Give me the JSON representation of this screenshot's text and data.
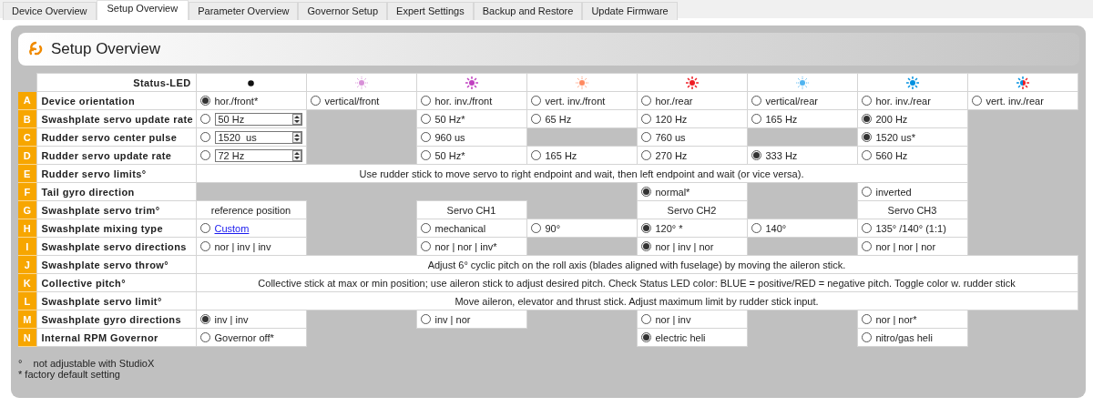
{
  "tabs": [
    {
      "label": "Device Overview",
      "selected": false
    },
    {
      "label": "Setup Overview",
      "selected": true
    },
    {
      "label": "Parameter Overview",
      "selected": false
    },
    {
      "label": "Governor Setup",
      "selected": false
    },
    {
      "label": "Expert Settings",
      "selected": false
    },
    {
      "label": "Backup and Restore",
      "selected": false
    },
    {
      "label": "Update Firmware",
      "selected": false
    }
  ],
  "panel": {
    "title": "Setup Overview"
  },
  "status_led": {
    "label": "Status-LED",
    "leds": [
      {
        "kind": "dot"
      },
      {
        "kind": "led",
        "color": "#d890d8",
        "blinking": true
      },
      {
        "kind": "led",
        "color": "#c040c0",
        "blinking": false
      },
      {
        "kind": "led",
        "color": "#ff8a60",
        "blinking": true
      },
      {
        "kind": "led",
        "color": "#ee1c24",
        "blinking": false
      },
      {
        "kind": "led",
        "color": "#50b4f0",
        "blinking": true
      },
      {
        "kind": "led",
        "color": "#0090e0",
        "blinking": false
      },
      {
        "kind": "alternating",
        "parts": [
          {
            "color": "#0090e0"
          },
          {
            "color": "#ee1c24"
          }
        ]
      }
    ]
  },
  "rows": [
    {
      "letter": "A",
      "label": "Device orientation",
      "cells": [
        {
          "kind": "option",
          "text": "hor./front*",
          "selected": true
        },
        {
          "kind": "option",
          "text": "vertical/front",
          "selected": false
        },
        {
          "kind": "option",
          "text": "hor. inv./front",
          "selected": false
        },
        {
          "kind": "option",
          "text": "vert. inv./front",
          "selected": false
        },
        {
          "kind": "option",
          "text": "hor./rear",
          "selected": false
        },
        {
          "kind": "option",
          "text": "vertical/rear",
          "selected": false
        },
        {
          "kind": "option",
          "text": "hor. inv./rear",
          "selected": false
        },
        {
          "kind": "option",
          "text": "vert. inv./rear",
          "selected": false
        }
      ]
    },
    {
      "letter": "B",
      "label": "Swashplate servo update rate",
      "cells": [
        {
          "kind": "spin",
          "value": "50 Hz",
          "selected": false
        },
        {
          "kind": "empty"
        },
        {
          "kind": "option",
          "text": "50 Hz*",
          "selected": false
        },
        {
          "kind": "option",
          "text": "65 Hz",
          "selected": false
        },
        {
          "kind": "option",
          "text": "120 Hz",
          "selected": false
        },
        {
          "kind": "option",
          "text": "165 Hz",
          "selected": false
        },
        {
          "kind": "option",
          "text": "200 Hz",
          "selected": true
        },
        {
          "kind": "empty"
        }
      ]
    },
    {
      "letter": "C",
      "label": "Rudder servo center pulse",
      "cells": [
        {
          "kind": "spin",
          "value": "1520  us",
          "selected": false
        },
        {
          "kind": "empty"
        },
        {
          "kind": "option",
          "text": "960 us",
          "selected": false
        },
        {
          "kind": "empty"
        },
        {
          "kind": "option",
          "text": "760 us",
          "selected": false
        },
        {
          "kind": "empty"
        },
        {
          "kind": "option",
          "text": "1520 us*",
          "selected": true
        },
        {
          "kind": "empty"
        }
      ]
    },
    {
      "letter": "D",
      "label": "Rudder servo update rate",
      "cells": [
        {
          "kind": "spin",
          "value": "72 Hz",
          "selected": false
        },
        {
          "kind": "empty"
        },
        {
          "kind": "option",
          "text": "50 Hz*",
          "selected": false
        },
        {
          "kind": "option",
          "text": "165 Hz",
          "selected": false
        },
        {
          "kind": "option",
          "text": "270 Hz",
          "selected": false
        },
        {
          "kind": "option",
          "text": "333 Hz",
          "selected": true
        },
        {
          "kind": "option",
          "text": "560 Hz",
          "selected": false
        },
        {
          "kind": "empty"
        }
      ]
    },
    {
      "letter": "E",
      "label": "Rudder servo limits°",
      "cells": [
        {
          "kind": "note",
          "text": "Use rudder stick to move servo to right endpoint and wait, then left endpoint and wait (or vice versa).",
          "spans_last_column": false
        }
      ]
    },
    {
      "letter": "F",
      "label": "Tail gyro direction",
      "cells": [
        {
          "kind": "empty"
        },
        {
          "kind": "empty"
        },
        {
          "kind": "empty"
        },
        {
          "kind": "empty"
        },
        {
          "kind": "option",
          "text": "normal*",
          "selected": true
        },
        {
          "kind": "empty"
        },
        {
          "kind": "option",
          "text": "inverted",
          "selected": false
        },
        {
          "kind": "empty"
        }
      ]
    },
    {
      "letter": "G",
      "label": "Swashplate servo trim°",
      "cells": [
        {
          "kind": "text",
          "text": "reference position"
        },
        {
          "kind": "empty"
        },
        {
          "kind": "text",
          "text": "Servo CH1"
        },
        {
          "kind": "empty"
        },
        {
          "kind": "text",
          "text": "Servo CH2"
        },
        {
          "kind": "empty"
        },
        {
          "kind": "text",
          "text": "Servo CH3"
        },
        {
          "kind": "empty"
        }
      ]
    },
    {
      "letter": "H",
      "label": "Swashplate mixing type",
      "cells": [
        {
          "kind": "link_option",
          "text": "Custom",
          "selected": false
        },
        {
          "kind": "empty"
        },
        {
          "kind": "option",
          "text": "mechanical",
          "selected": false
        },
        {
          "kind": "option",
          "text": "90°",
          "selected": false
        },
        {
          "kind": "option",
          "text": "120°  *",
          "selected": true
        },
        {
          "kind": "option",
          "text": "140°",
          "selected": false
        },
        {
          "kind": "option",
          "text": "135° /140° (1:1)",
          "selected": false
        },
        {
          "kind": "empty"
        }
      ]
    },
    {
      "letter": "I",
      "label": "Swashplate servo directions",
      "cells": [
        {
          "kind": "option",
          "text": "nor | inv | inv",
          "selected": false
        },
        {
          "kind": "empty"
        },
        {
          "kind": "option",
          "text": "nor | nor | inv*",
          "selected": false
        },
        {
          "kind": "empty"
        },
        {
          "kind": "option",
          "text": "nor | inv | nor",
          "selected": true
        },
        {
          "kind": "empty"
        },
        {
          "kind": "option",
          "text": "nor | nor | nor",
          "selected": false
        },
        {
          "kind": "empty"
        }
      ]
    },
    {
      "letter": "J",
      "label": "Swashplate servo throw°",
      "cells": [
        {
          "kind": "note",
          "text": "Adjust 6°   cyclic pitch on the roll axis (blades aligned with fuselage) by moving the aileron stick.",
          "spans_last_column": true
        }
      ]
    },
    {
      "letter": "K",
      "label": "Collective pitch°",
      "cells": [
        {
          "kind": "note",
          "text": "Collective stick at max or min position; use aileron stick to adjust desired pitch. Check Status LED color: BLUE = positive/RED = negative pitch. Toggle color w. rudder stick",
          "spans_last_column": true
        }
      ]
    },
    {
      "letter": "L",
      "label": "Swashplate servo limit°",
      "cells": [
        {
          "kind": "note",
          "text": "Move aileron, elevator and thrust stick. Adjust maximum limit by rudder stick input.",
          "spans_last_column": true
        }
      ]
    },
    {
      "letter": "M",
      "label": "Swashplate gyro directions",
      "cells": [
        {
          "kind": "option",
          "text": "inv | inv",
          "selected": true
        },
        {
          "kind": "empty"
        },
        {
          "kind": "option",
          "text": "inv | nor",
          "selected": false
        },
        {
          "kind": "empty"
        },
        {
          "kind": "option",
          "text": "nor | inv",
          "selected": false
        },
        {
          "kind": "empty"
        },
        {
          "kind": "option",
          "text": "nor | nor*",
          "selected": false
        },
        {
          "kind": "empty"
        }
      ]
    },
    {
      "letter": "N",
      "label": "Internal RPM Governor",
      "cells": [
        {
          "kind": "option",
          "text": "Governor off*",
          "selected": false
        },
        {
          "kind": "empty"
        },
        {
          "kind": "empty"
        },
        {
          "kind": "empty"
        },
        {
          "kind": "option",
          "text": "electric heli",
          "selected": true
        },
        {
          "kind": "empty"
        },
        {
          "kind": "option",
          "text": "nitro/gas heli",
          "selected": false
        },
        {
          "kind": "empty"
        }
      ]
    }
  ],
  "footnotes": [
    "°    not adjustable with StudioX",
    "* factory default setting"
  ]
}
